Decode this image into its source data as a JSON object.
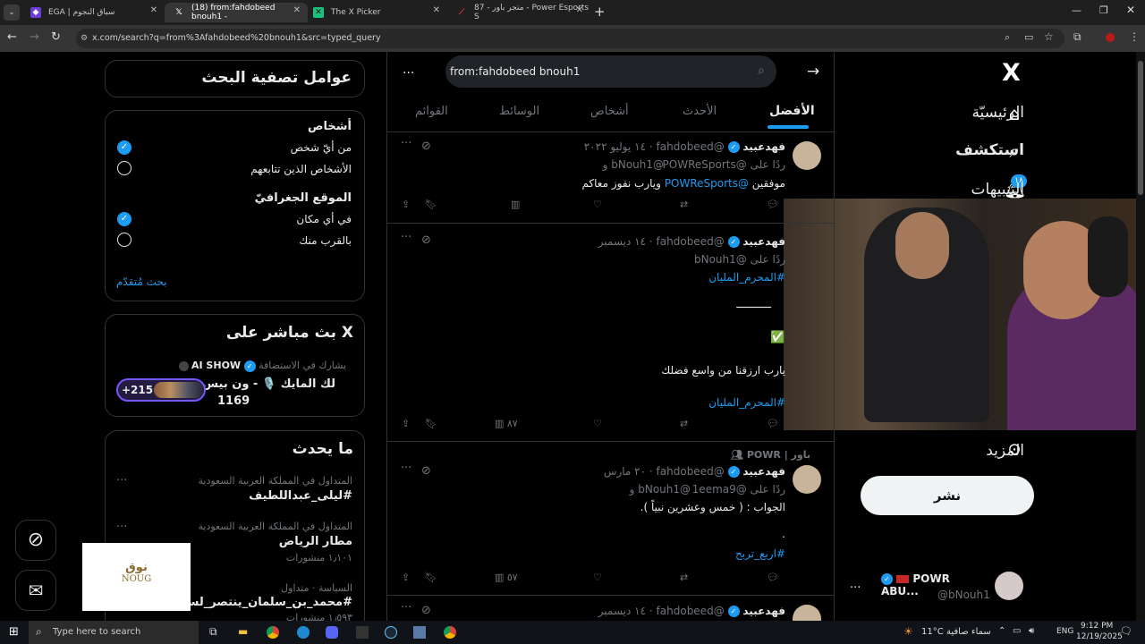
{
  "browser": {
    "tabs": [
      {
        "label": "EGA | سباق النجوم",
        "active": false
      },
      {
        "label": "(18) from:fahdobeed bnouh1 -",
        "active": true
      },
      {
        "label": "The X Picker",
        "active": false
      },
      {
        "label": "87 - متجر باور - Power Esports S",
        "active": false
      }
    ],
    "new_tab": "+",
    "url": "x.com/search?q=from%3Afahdobeed%20bnouh1&src=typed_query"
  },
  "nav": {
    "logo": "X",
    "items": [
      {
        "label": "الرئيسيّة",
        "icon": "home-icon"
      },
      {
        "label": "استكشف",
        "icon": "search-icon"
      },
      {
        "label": "التنبيهات",
        "icon": "bell-icon",
        "badge": "١٨"
      }
    ],
    "more": "المزيد",
    "post_button": "نشر",
    "account": {
      "name": "POWR ABU...",
      "handle": "@bNouh1",
      "menu": "..."
    }
  },
  "search": {
    "query": "from:fahdobeed bnouh1",
    "tabs": [
      "الأفضل",
      "الأحدث",
      "أشخاص",
      "الوسائط",
      "القوائم"
    ],
    "active_tab": "الأفضل",
    "more": "..."
  },
  "posts": [
    {
      "name": "فهدعبيد",
      "handle": "@fahdobeed",
      "date": "١٤ يوليو ٢٠٢٢",
      "reply_line": "ردًا على @POWReSports",
      "reply_line2": "@bNouh1 و",
      "text_prefix": "موفقين",
      "text_mention": "@POWReSports",
      "text_suffix": "ويارب نفوز معاكم",
      "views": ""
    },
    {
      "name": "فهدعبيد",
      "handle": "@fahdobeed",
      "date": "١٤ ديسمبر",
      "reply_line": "ردًا على @bNouh1",
      "hashtag": "#المحرم_المليان",
      "dash": "ـــــــــــ",
      "check": "✅",
      "text": "يارب ارزقنا من واسع فضلك",
      "hashtag2": "#المحرم_المليان",
      "views": "٨٧"
    },
    {
      "repost_label": "باور | POWR",
      "name": "فهدعبيد",
      "handle": "@fahdobeed",
      "date": "٢٠ مارس",
      "reply_line": "ردًا على @1eema9",
      "reply_line2": "@bNouh1 و",
      "text": "الجواب : ( خمس وعشرين نبياً ).",
      "dot": ".",
      "hashtag": "#اربع_تربح",
      "views": "٥٧"
    },
    {
      "name": "فهدعبيد",
      "handle": "@fahdobeed",
      "date": "١٤ ديسمبر"
    }
  ],
  "filters": {
    "title": "عوامل تصفية البحث",
    "people_title": "أشخاص",
    "people_options": [
      "من أيّ شخص",
      "الأشخاص الذين تتابعهم"
    ],
    "people_selected": 0,
    "location_title": "الموقع الجغرافيّ",
    "location_options": [
      "في أي مكان",
      "بالقرب منك"
    ],
    "location_selected": 0,
    "advanced": "بحث مُتقدّم"
  },
  "live": {
    "title": "X بث مباشر على",
    "host_line": "يشارك في الاستضافة",
    "host_name": "AI SHOW",
    "space_title": "لك المايك 🎙️ - ون بيس",
    "space_count": "1169",
    "listeners": "+215"
  },
  "trends": {
    "title": "ما يحدث",
    "items": [
      {
        "context": "المتداول في المملكة العربية السعودية",
        "topic": "#ليلى_عبداللطيف",
        "posts": ""
      },
      {
        "context": "المتداول في المملكة العربية السعودية",
        "topic": "مطار الرياض",
        "posts": "١٫١٠١ منشورات"
      },
      {
        "context": "السياسة · متداول",
        "topic": "#محمد_بن_سلمان_ينتصر_لسـ",
        "posts": "١٫٥٩٣ منشورات"
      }
    ]
  },
  "overlay": {
    "logo_ar": "نوق",
    "logo_en": "NOUG"
  },
  "taskbar": {
    "search_placeholder": "Type here to search",
    "weather": "11°C",
    "weather_label": "سماء صافية",
    "lang": "ENG",
    "time": "9:12 PM",
    "date": "12/19/2025"
  },
  "colors": {
    "accent": "#1d9bf0",
    "bg": "#000000",
    "border": "#2f3336",
    "muted": "#71767b"
  }
}
